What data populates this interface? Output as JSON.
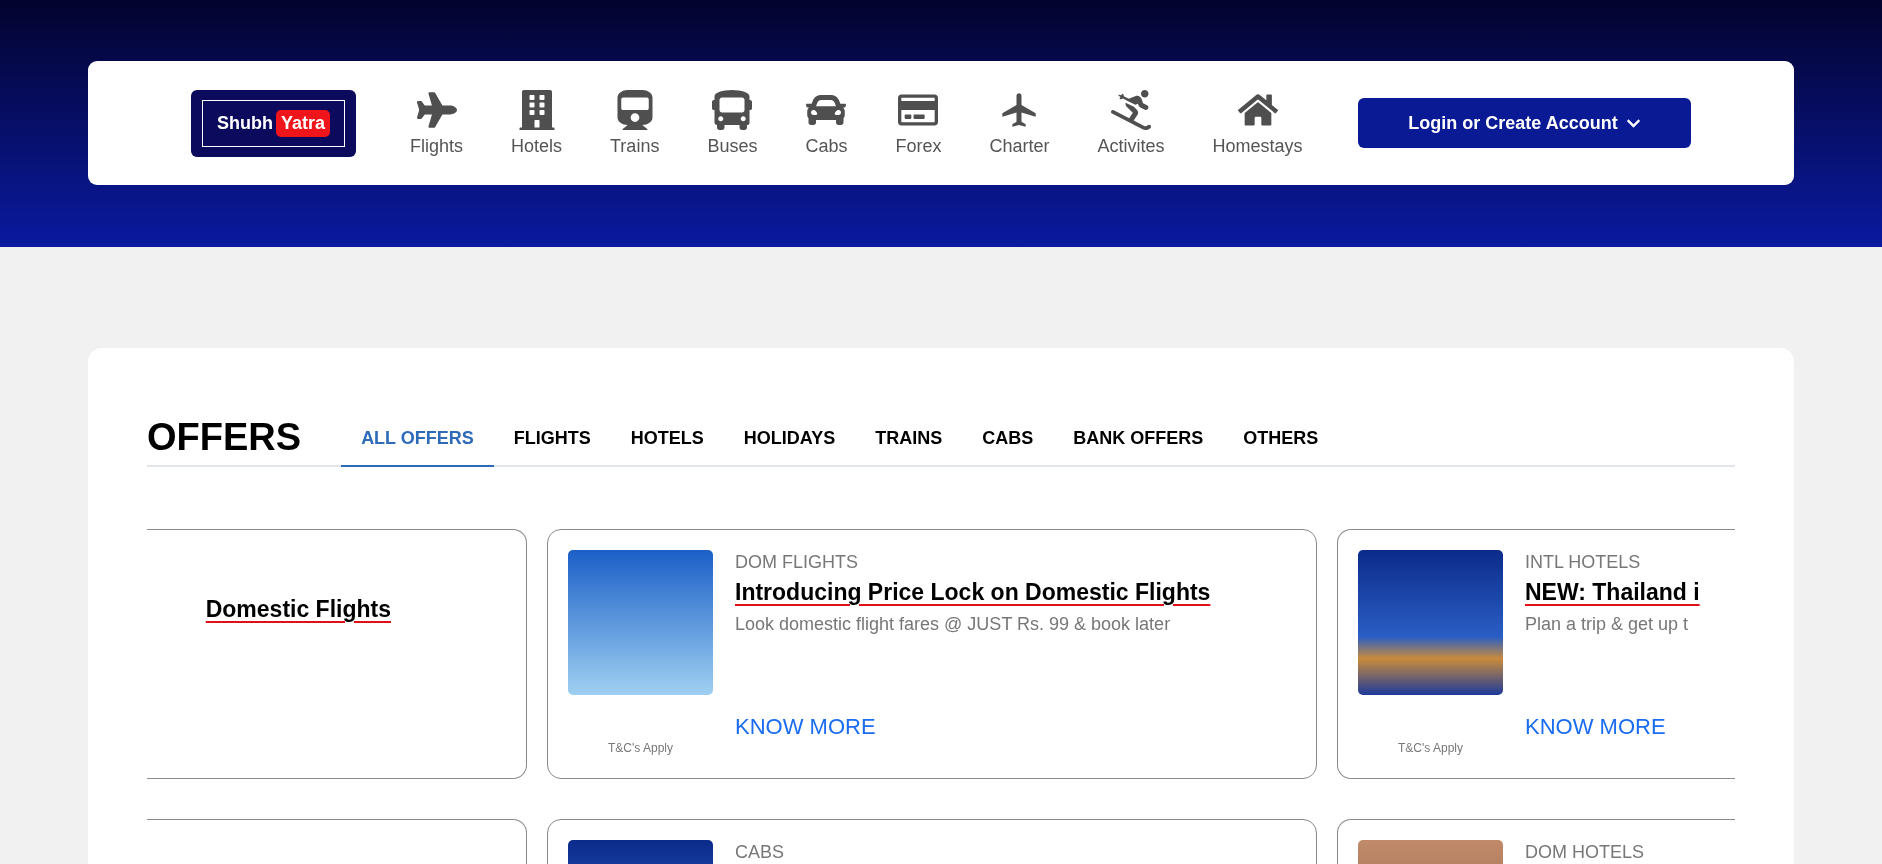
{
  "header": {
    "logo": {
      "word_1": "Shubh",
      "word_2": "Yatra"
    },
    "nav": [
      {
        "label": "Flights"
      },
      {
        "label": "Hotels"
      },
      {
        "label": "Trains"
      },
      {
        "label": "Buses"
      },
      {
        "label": "Cabs"
      },
      {
        "label": "Forex"
      },
      {
        "label": "Charter"
      },
      {
        "label": "Activites"
      },
      {
        "label": "Homestays"
      }
    ],
    "login_button": "Login or Create Account"
  },
  "offers": {
    "title": "OFFERS",
    "tabs": [
      {
        "label": "ALL OFFERS",
        "selected": true
      },
      {
        "label": "FLIGHTS",
        "selected": false
      },
      {
        "label": "HOTELS",
        "selected": false
      },
      {
        "label": "HOLIDAYS",
        "selected": false
      },
      {
        "label": "TRAINS",
        "selected": false
      },
      {
        "label": "CABS",
        "selected": false
      },
      {
        "label": "BANK OFFERS",
        "selected": false
      },
      {
        "label": "OTHERS",
        "selected": false
      }
    ],
    "rows": [
      [
        {
          "kind": "left_cut",
          "title": "Domestic Flights"
        },
        {
          "kind": "full",
          "category": "DOM FLIGHTS",
          "title": "Introducing Price Lock on Domestic Flights",
          "description": "Look domestic flight fares @ JUST Rs. 99 & book later",
          "link": "KNOW MORE",
          "terms": "T&C's Apply"
        },
        {
          "kind": "right_cut",
          "category": "INTL HOTELS",
          "title": "NEW: Thailand i",
          "description": "Plan a trip & get up t",
          "link": "KNOW MORE",
          "terms": "T&C's Apply"
        }
      ],
      [
        {
          "kind": "left_cut"
        },
        {
          "kind": "full",
          "category": "CABS"
        },
        {
          "kind": "right_cut",
          "category": "DOM HOTELS"
        }
      ]
    ]
  }
}
